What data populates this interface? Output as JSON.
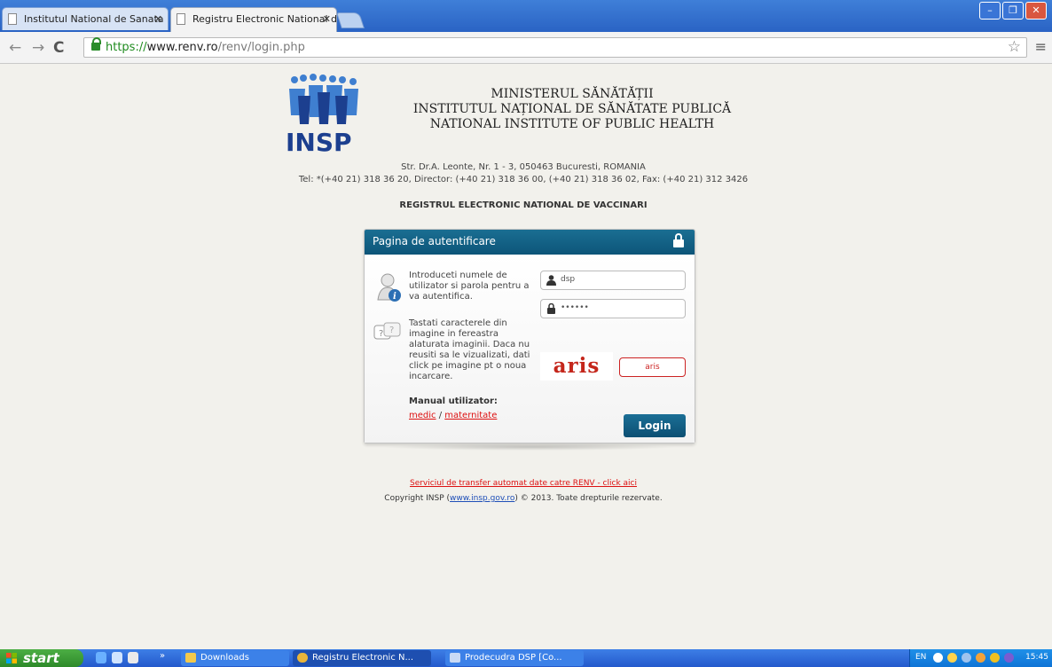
{
  "browser": {
    "tabs": [
      {
        "title": "Institutul National de Sanata",
        "active": false
      },
      {
        "title": "Registru Electronic National d",
        "active": true
      }
    ],
    "url": {
      "scheme": "https://",
      "host": "www.renv.ro",
      "path": "/renv/login.php"
    }
  },
  "header": {
    "logo_text": "INSP",
    "ministry": "MINISTERUL SĂNĂTĂȚII",
    "institute_ro": "INSTITUTUL NAȚIONAL DE SĂNĂTATE PUBLICĂ",
    "institute_en": "NATIONAL INSTITUTE OF PUBLIC HEALTH",
    "address": "Str. Dr.A. Leonte, Nr. 1 - 3, 050463 Bucuresti, ROMANIA",
    "phones": "Tel: *(+40 21) 318 36 20, Director: (+40 21) 318 36 00, (+40 21) 318 36 02, Fax: (+40 21) 312 3426",
    "registry_title": "REGISTRUL ELECTRONIC NATIONAL DE VACCINARI"
  },
  "login": {
    "title": "Pagina de autentificare",
    "instructions": "Introduceti numele de utilizator si parola pentru a va autentifica.",
    "captcha_instructions": "Tastati caracterele din imagine in fereastra alaturata imaginii. Daca nu reusiti sa le vizualizati, dati click pe imagine pt o noua incarcare.",
    "manual_label": "Manual utilizator:",
    "manual_link_medic": "medic",
    "manual_separator": " / ",
    "manual_link_maternitate": "maternitate",
    "username_value": "dsp",
    "password_value": "••••••",
    "captcha_image_text": "aris",
    "captcha_value": "aris",
    "login_button": "Login"
  },
  "footer": {
    "transfer_link": "Serviciul de transfer automat date catre RENV - click aici",
    "copyright_prefix": "Copyright INSP (",
    "copyright_link": "www.insp.gov.ro",
    "copyright_suffix": ") © 2013. Toate drepturile rezervate."
  },
  "taskbar": {
    "start_label": "start",
    "items": [
      {
        "label": "Downloads"
      },
      {
        "label": "Registru Electronic N..."
      },
      {
        "label": "Prodecudra DSP [Co..."
      }
    ],
    "language": "EN",
    "clock": "15:45"
  },
  "colors": {
    "card_header": "#0f5b80",
    "link_red": "#dd1111",
    "captcha_red": "#c4261b"
  }
}
